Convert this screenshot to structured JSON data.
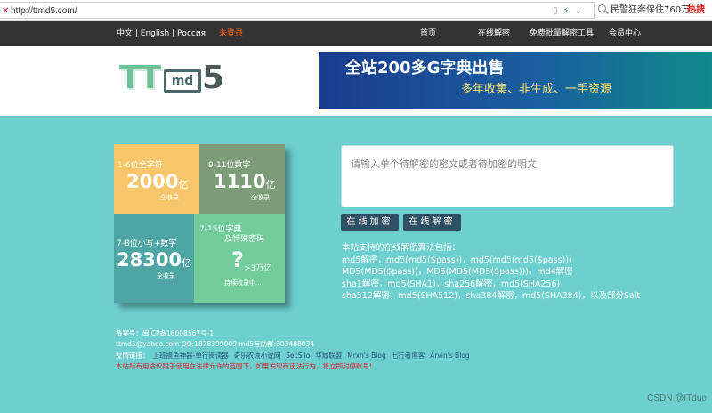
{
  "browser": {
    "url": "http://ttmd5.com/",
    "search_text": "民警狂奔保住760万",
    "hot_label": "热搜"
  },
  "topnav": {
    "lang": "中文 | English | Россия",
    "login": "未登录",
    "items": [
      "首页",
      "在线解密",
      "免费批量解密工具",
      "会员中心"
    ]
  },
  "header": {
    "logo_tt": "TT",
    "logo_md": "md",
    "logo_five": "5",
    "banner_title": "全站200多G字典出售",
    "banner_sub": "多年收集、非生成、一手资源"
  },
  "tiles": [
    {
      "label": "1-6位全字符",
      "big": "2000",
      "unit": "亿",
      "sub": "全收录",
      "color": "#f7c56a"
    },
    {
      "label": "9-11位数字",
      "big": "1110",
      "unit": "亿",
      "sub": "全收录",
      "color": "#7c9d78"
    },
    {
      "label": "7-8位小写+数字",
      "big": "28300",
      "unit": "亿",
      "sub": "全收录",
      "color": "#4fa4a4"
    },
    {
      "label": "7-15位字典",
      "label2": "及特殊密码",
      "big": "?",
      "unit": ">3万亿",
      "sub": "持续收录中...",
      "color": "#72cd9a"
    }
  ],
  "form": {
    "placeholder": "请输入单个待解密的密文或者待加密的明文",
    "encrypt_label": "在线加密",
    "decrypt_label": "在线解密"
  },
  "algos": [
    "本站支持的在线解密算法包括：",
    "md5解密，md5(md5($pass))，md5(md5(md5($pass)))",
    "MD5(MD5($pass))，MD5(MD5(MD5($pass)))，md4解密",
    "sha1解密，md5(SHA1)，sha256解密，md5(SHA256)",
    "sha512解密，md5(SHA512)，sha384解密，md5(SHA384)，以及部分Salt"
  ],
  "footer": {
    "icp": "备案号：闽ICP备16008567号-1",
    "contact": "ttmd5@yahoo.com  QQ:1878399009  md5互助群:303488034",
    "links_label": "友情链接：",
    "links": [
      "上班摸鱼神器-单行阅读器",
      "奇乐农诙小说网",
      "SecSilo",
      "华城联盟",
      "Mrxn's Blog",
      "七行者博客",
      "Arvin's Blog"
    ],
    "warning": "本站所有用途仅限于使用在法律允许的范围下，如果发现有违法行为，将立即封停账号!"
  },
  "watermark": "CSDN @ITduo",
  "colors": {
    "background": "#6ecfcf",
    "topnav": "#333333",
    "login_orange": "#ff6a00",
    "button": "#2f4f63",
    "warning_red": "#d9232e"
  }
}
